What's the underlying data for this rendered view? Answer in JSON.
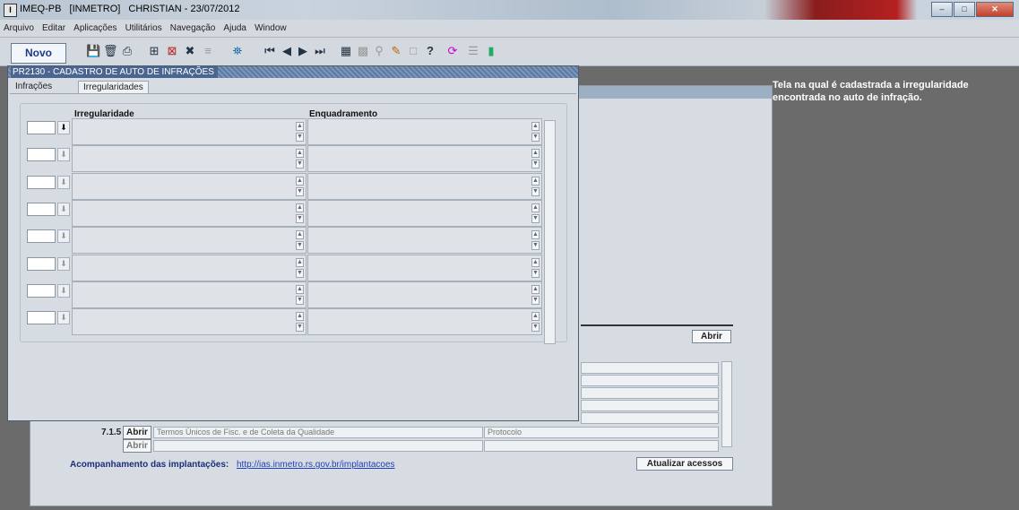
{
  "window": {
    "title_parts": [
      "IMEQ-PB",
      "[INMETRO]",
      "CHRISTIAN - 23/07/2012"
    ],
    "app_icon": "I"
  },
  "menu": [
    "Arquivo",
    "Editar",
    "Aplicações",
    "Utilitários",
    "Navegação",
    "Ajuda",
    "Window"
  ],
  "toolbar": {
    "novo_label": "Novo",
    "icons": [
      "save-icon",
      "delete-icon",
      "print-icon",
      "insert-record-icon",
      "delete-record-icon",
      "clear-icon",
      "disabled-icon",
      "query-icon",
      "first-record-icon",
      "previous-record-icon",
      "next-record-icon",
      "last-record-icon",
      "calculator-icon",
      "grid-icon",
      "search-icon",
      "edit-icon",
      "attach-icon",
      "help-icon",
      "refresh-icon",
      "list-icon",
      "exit-icon"
    ]
  },
  "help_text": "Tela na qual é cadastrada a irregularidade encontrada no auto de infração.",
  "form": {
    "title": "PR2130 - CADASTRO DE AUTO DE INFRAÇÕES",
    "tabs": [
      {
        "label": "Infrações",
        "active": false
      },
      {
        "label": "Irregularidades",
        "active": true
      }
    ],
    "headers": {
      "irregularidade": "Irregularidade",
      "enquadramento": "Enquadramento"
    },
    "row_count": 8
  },
  "background": {
    "abrir_label": "Abrir",
    "item_number": "7.1.5",
    "item_text": "Termos Únicos de Fisc. e de Coleta da Qualidade",
    "item_protocol": "Protocolo",
    "acompanhamento_label": "Acompanhamento das implantações:",
    "acompanhamento_url": "http://ias.inmetro.rs.gov.br/implantacoes",
    "atualizar_label": "Atualizar acessos"
  }
}
